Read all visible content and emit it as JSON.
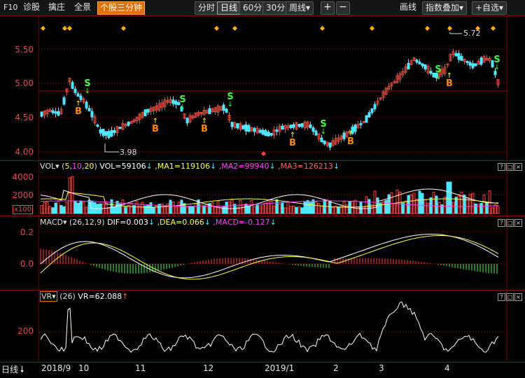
{
  "toolbar": {
    "left_items": [
      "F10",
      "诊股",
      "擒庄",
      "全景"
    ],
    "active_item": "个股三分钟",
    "periods": [
      "分时",
      "日线",
      "60分",
      "30分",
      "周线▾"
    ],
    "selected_period": "日线",
    "zoom_in": "+",
    "zoom_out": "−",
    "right_items": [
      "画线",
      "指数叠加▾",
      "+自选▾"
    ]
  },
  "price_panel": {
    "y_ticks": [
      "5.50",
      "5.00",
      "4.50",
      "4.00"
    ],
    "high_label": "5.72",
    "low_label": "3.98",
    "signal_buy": "B",
    "signal_sell": "S"
  },
  "vol_panel": {
    "name": "VOL▾",
    "params_open": "(",
    "params": [
      "5",
      "10",
      "20"
    ],
    "params_close": ")",
    "vol": "VOL=59106",
    "ma1": ",MA1=119106",
    "ma2": ",MA2=99940",
    "ma3": ",MA3=126213",
    "y_ticks": [
      "4000",
      "2000"
    ],
    "unit": "x100"
  },
  "macd_panel": {
    "name": "MACD▾",
    "params": "(26,12,9)",
    "dif": "DIF=0.003",
    "dea": ",DEA=0.066",
    "macd": ",MACD=-0.127",
    "y_ticks": [
      "0.2",
      "0.0"
    ]
  },
  "vr_panel": {
    "name": "VR▾",
    "params": "(26)",
    "vr": "VR=62.088",
    "y_ticks": [
      "200"
    ]
  },
  "panel_controls": [
    "?",
    "□",
    "×"
  ],
  "x_axis": {
    "period_label": "日线",
    "labels": [
      "2018/9",
      "10",
      "11",
      "12",
      "2019/1",
      "2",
      "3",
      "4"
    ]
  },
  "colors": {
    "up": "#ff4040",
    "down": "#4fe6ff",
    "grid": "#7a0000",
    "ma1": "#ffffff",
    "ma2": "#ffff40",
    "ma3": "#ff40ff",
    "buy": "#ff8800",
    "sell": "#40ff40"
  }
}
